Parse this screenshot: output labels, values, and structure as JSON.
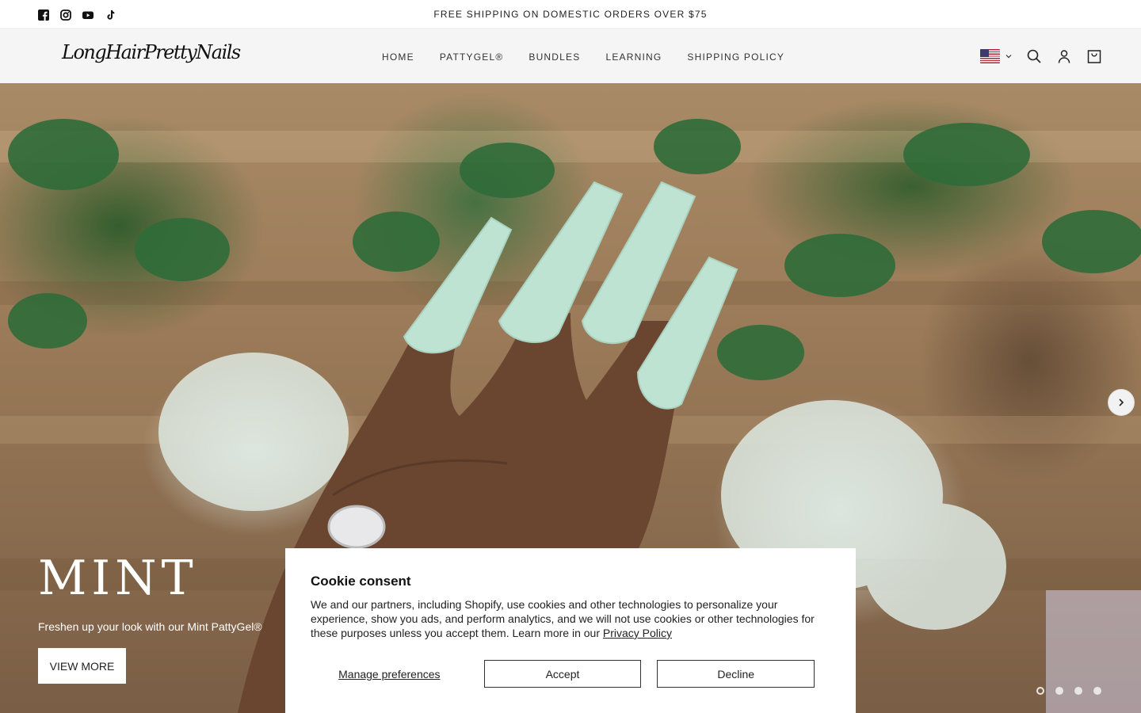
{
  "announcement": "FREE SHIPPING ON DOMESTIC ORDERS OVER $75",
  "social": [
    "facebook-icon",
    "instagram-icon",
    "youtube-icon",
    "tiktok-icon"
  ],
  "header": {
    "logo": "LongHairPrettyNails",
    "nav": [
      "HOME",
      "PATTYGEL®",
      "BUNDLES",
      "LEARNING",
      "SHIPPING POLICY"
    ],
    "tools": [
      "us-flag-icon",
      "chevron-down-icon",
      "search-icon",
      "account-icon",
      "cart-icon"
    ]
  },
  "hero": {
    "title": "MINT",
    "subtitle": "Freshen up your look with our Mint PattyGel®",
    "cta": "VIEW MORE",
    "slides_total": 4,
    "active_slide": 1
  },
  "cookie": {
    "title": "Cookie consent",
    "body": "We and our partners, including Shopify, use cookies and other technologies to personalize your experience, show you ads, and perform analytics, and we will not use cookies or other technologies for these purposes unless you accept them. Learn more in our ",
    "privacy_link": "Privacy Policy",
    "manage": "Manage preferences",
    "accept": "Accept",
    "decline": "Decline"
  },
  "colors": {
    "mint": "#bfe3d2",
    "header_bg": "#f5f5f5",
    "text": "#111111"
  }
}
